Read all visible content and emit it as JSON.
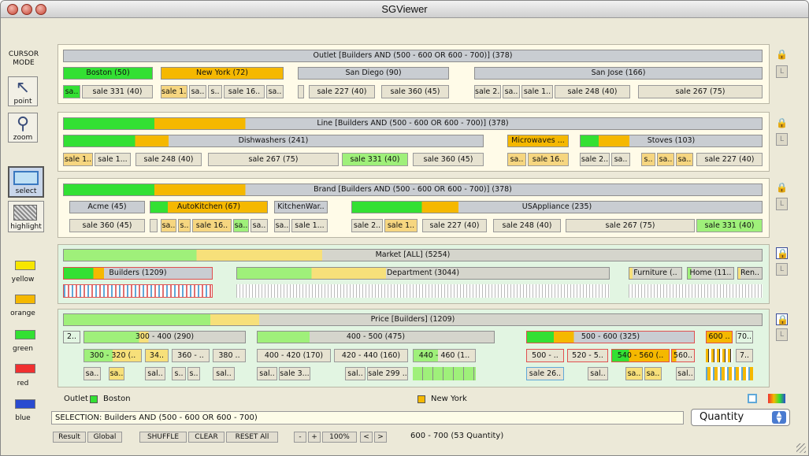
{
  "window": {
    "title": "SGViewer"
  },
  "sidebar": {
    "cursor_mode": "CURSOR MODE",
    "point": "point",
    "zoom": "zoom",
    "select": "select",
    "highlight": "highlight",
    "colors": [
      "yellow",
      "orange",
      "green",
      "red",
      "blue"
    ]
  },
  "outlet": {
    "header": "Outlet [Builders AND (500 - 600 OR 600 - 700)] (378)",
    "groups": [
      "Boston (50)",
      "New York (72)",
      "San Diego (90)",
      "San Jose (166)"
    ],
    "cells": [
      "sa..",
      "sale 331 (40)",
      "sale 1..",
      "sa..",
      "s..",
      "sale 16..",
      "sa..",
      "sale 227 (40)",
      "sale 360 (45)",
      "sale 2..",
      "sa..",
      "sale 1..",
      "sale 248 (40)",
      "sale 267 (75)"
    ]
  },
  "line": {
    "header": "Line [Builders AND (500 - 600 OR 600 - 700)] (378)",
    "groups": [
      "Dishwashers (241)",
      "Microwaves ...",
      "Stoves (103)"
    ],
    "cells": [
      "sale 1..",
      "sale 1...",
      "sale 248 (40)",
      "sale 267 (75)",
      "sale 331 (40)",
      "sale 360 (45)",
      "sa..",
      "sale 16..",
      "sale 2..",
      "sa..",
      "s..",
      "sa..",
      "sa..",
      "sale 227 (40)"
    ]
  },
  "brand": {
    "header": "Brand [Builders AND (500 - 600 OR 600 - 700)] (378)",
    "groups": [
      "Acme (45)",
      "AutoKitchen (67)",
      "KitchenWar..",
      "USAppliance (235)"
    ],
    "cells": [
      "sale 360 (45)",
      "sa..",
      "s..",
      "sale 16..",
      "sa..",
      "sa..",
      "sa..",
      "sale 1...",
      "sale 2..",
      "sale 1..",
      "sale 227 (40)",
      "sale 248 (40)",
      "sale 267 (75)",
      "sale 331 (40)"
    ]
  },
  "market": {
    "header": "Market [ALL] (5254)",
    "groups": [
      "Builders (1209)",
      "Department (3044)",
      "Furniture (..",
      "Home (11..",
      "Ren.."
    ]
  },
  "price": {
    "header": "Price [Builders] (1209)",
    "groups": [
      "2..",
      "300 - 400 (290)",
      "400 - 500 (475)",
      "500 - 600 (325)",
      "600 ..",
      "70.."
    ],
    "sub": [
      "300 - 320 (..",
      "34..",
      "360 - ..",
      "380 ..",
      "400 - 420 (170)",
      "420 - 440 (160)",
      "440 - 460 (1..",
      "500 - ..",
      "520 - 5..",
      "540 - 560 (..",
      "560..",
      "7.."
    ],
    "cells": [
      "sa..",
      "sa..",
      "sal..",
      "s..",
      "s..",
      "sal..",
      "sal..",
      "sale 3...",
      "sal..",
      "sale 299 ..",
      "sale 26..",
      "sal..",
      "sa..",
      "sa..",
      "sal.."
    ]
  },
  "legend": {
    "dim": "Outlet",
    "items": [
      "Boston",
      "New York"
    ]
  },
  "selection": {
    "label": "SELECTION:",
    "value": "Builders AND (500 - 600 OR 600 - 700)"
  },
  "measure": "Quantity",
  "toolbar": {
    "result": "Result",
    "global": "Global",
    "shuffle": "SHUFFLE",
    "clear": "CLEAR",
    "reset": "RESET All",
    "minus": "-",
    "plus": "+",
    "zoom": "100%",
    "prev": "<",
    "next": ">"
  },
  "status": "600 - 700 (53 Quantity)",
  "colors": {
    "green": "#33e033",
    "orange": "#f5b800",
    "yellow": "#f7e600",
    "red": "#f03030",
    "blue": "#2a4bd0",
    "gray": "#c9cdd2",
    "lightgreen": "#9ff07a",
    "paleorange": "#f6d680"
  }
}
